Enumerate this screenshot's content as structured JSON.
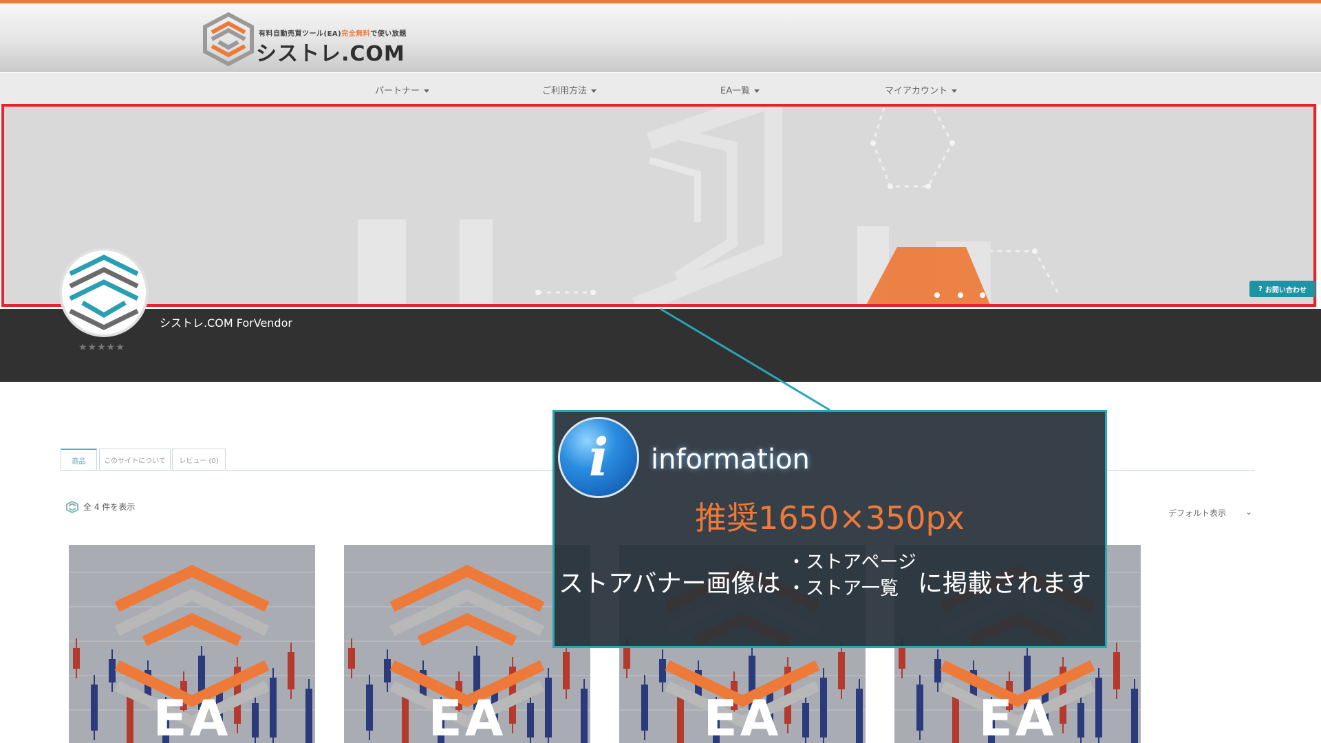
{
  "header": {
    "tagline_prefix": "有料自動売買ツール(EA)",
    "tagline_free": "完全無料",
    "tagline_suffix": "で使い放題",
    "brand": "シストレ.COM"
  },
  "nav": {
    "items": [
      {
        "label": "パートナー"
      },
      {
        "label": "ご利用方法"
      },
      {
        "label": "EA一覧"
      },
      {
        "label": "マイアカウント"
      }
    ]
  },
  "banner": {
    "contact_label": "お問い合わせ"
  },
  "vendor": {
    "name": "シストレ.COM ForVendor",
    "stars": "★★★★★",
    "rating_stars": 0
  },
  "tabs": [
    {
      "label": "商品"
    },
    {
      "label": "このサイトについて"
    },
    {
      "label": "レビュー (0)"
    }
  ],
  "shop": {
    "result_count": "全 4 件を表示",
    "sort_label": "デフォルト表示",
    "sort_chevron": "⌄"
  },
  "products": [
    {
      "label": "EA"
    },
    {
      "label": "EA"
    },
    {
      "label": "EA"
    },
    {
      "label": "EA"
    }
  ],
  "info_box": {
    "icon_letter": "i",
    "title": "information",
    "spec": "推奨1650×350px",
    "lead": "ストアバナー画像は",
    "list": [
      "・ストアページ",
      "・ストア一覧"
    ],
    "tail": "に掲載されます"
  },
  "colors": {
    "accent_orange": "#ee7a3a",
    "highlight_red": "#e8222a",
    "teal": "#27a6b8",
    "dark_bar": "#313131"
  }
}
